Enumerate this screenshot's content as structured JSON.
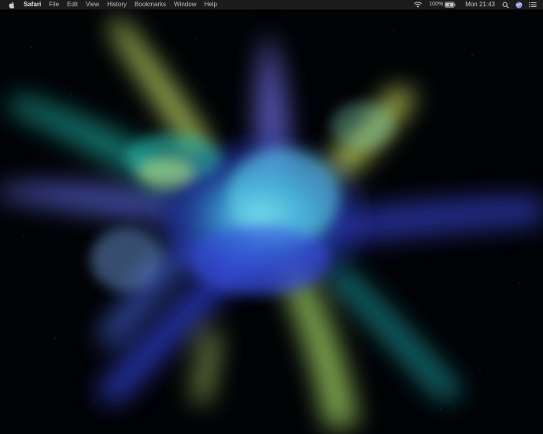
{
  "menubar": {
    "apple_icon": "apple-logo-icon",
    "app_name": "Safari",
    "menus": [
      "File",
      "Edit",
      "View",
      "History",
      "Bookmarks",
      "Window",
      "Help"
    ],
    "status": {
      "wifi_icon": "wifi-icon",
      "battery_percent": "100%",
      "battery_icon": "battery-charging-icon",
      "clock": "Mon 21:43",
      "spotlight_icon": "magnifier-icon",
      "siri_icon": "siri-icon",
      "notification_icon": "list-icon"
    }
  },
  "wallpaper": {
    "description_icon": "color-powder-explosion-wallpaper",
    "colors": {
      "background": "#020306",
      "blue": "#2f55d8",
      "cyan": "#2ec8d9",
      "teal": "#1fa59a",
      "lime": "#c9e36a",
      "violet": "#5b55d6"
    }
  }
}
